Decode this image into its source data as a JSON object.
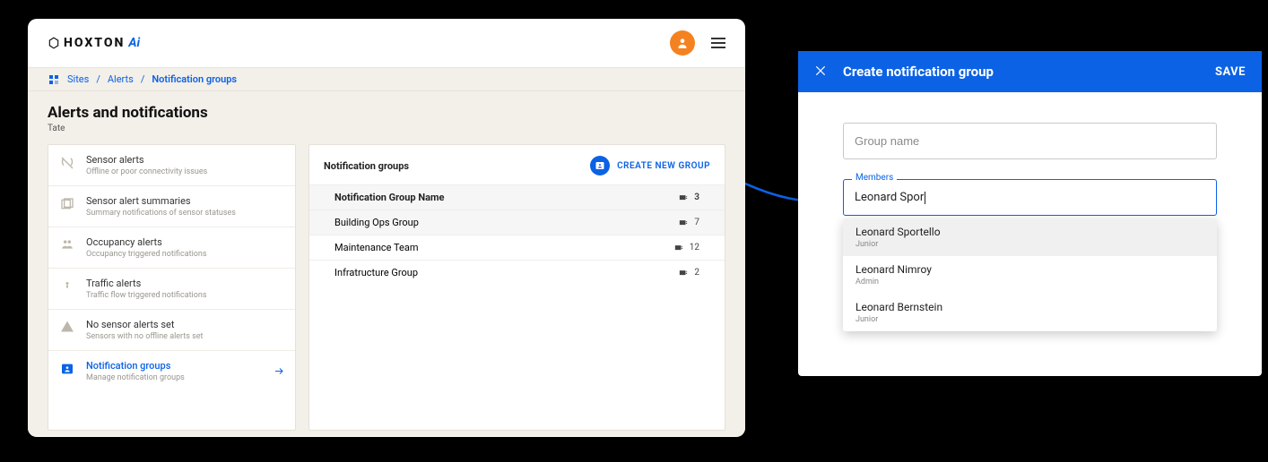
{
  "logo": {
    "text": "HOXTON",
    "suffix": "Ai"
  },
  "breadcrumb": {
    "items": [
      "Sites",
      "Alerts",
      "Notification groups"
    ]
  },
  "page": {
    "title": "Alerts and notifications",
    "subtitle": "Tate"
  },
  "sidebar": {
    "items": [
      {
        "icon": "sensor",
        "title": "Sensor alerts",
        "sub": "Offline or poor connectivity issues"
      },
      {
        "icon": "summary",
        "title": "Sensor alert summaries",
        "sub": "Summary notifications of sensor statuses"
      },
      {
        "icon": "occupancy",
        "title": "Occupancy alerts",
        "sub": "Occupancy triggered notifications"
      },
      {
        "icon": "traffic",
        "title": "Traffic alerts",
        "sub": "Traffic flow triggered notifications"
      },
      {
        "icon": "warning",
        "title": "No sensor alerts set",
        "sub": "Sensors with no offline alerts set"
      },
      {
        "icon": "group",
        "title": "Notification groups",
        "sub": "Manage notification groups",
        "active": true
      }
    ]
  },
  "main": {
    "header": "Notification groups",
    "create_label": "CREATE NEW GROUP",
    "table_header": {
      "name": "Notification Group Name",
      "count": "3"
    },
    "rows": [
      {
        "name": "Building Ops Group",
        "count": "7"
      },
      {
        "name": "Maintenance Team",
        "count": "12"
      },
      {
        "name": "Infratructure Group",
        "count": "2"
      }
    ]
  },
  "modal": {
    "title": "Create notification group",
    "save": "SAVE",
    "group_name_placeholder": "Group name",
    "members_label": "Members",
    "members_value": "Leonard Spor",
    "suggestions": [
      {
        "name": "Leonard Sportello",
        "role": "Junior"
      },
      {
        "name": "Leonard Nimroy",
        "role": "Admin"
      },
      {
        "name": "Leonard Bernstein",
        "role": "Junior"
      }
    ]
  }
}
